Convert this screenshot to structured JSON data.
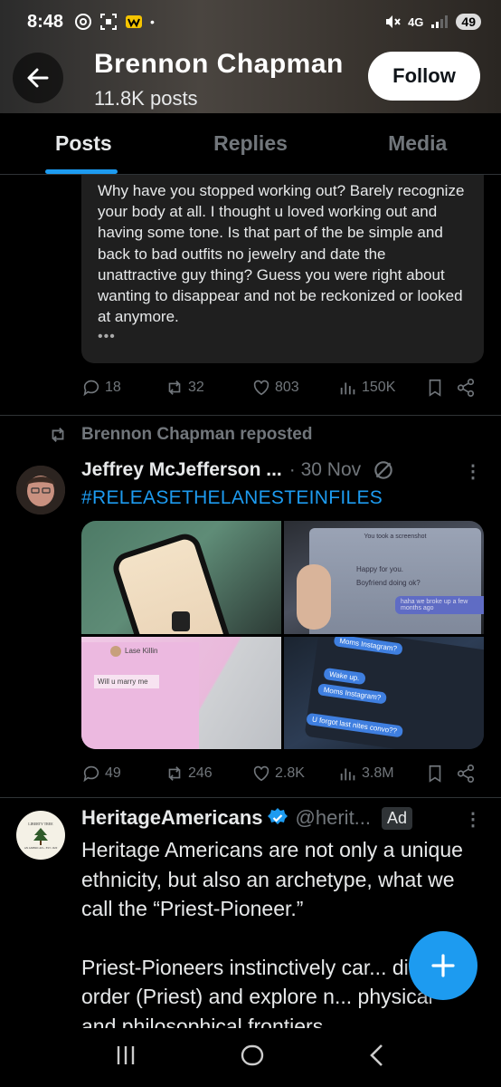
{
  "status_bar": {
    "time": "8:48",
    "network": "4G",
    "battery": "49"
  },
  "header": {
    "name": "Brennon Chapman",
    "posts_count": "11.8K posts",
    "follow_label": "Follow"
  },
  "tabs": [
    {
      "label": "Posts",
      "active": true
    },
    {
      "label": "Replies",
      "active": false
    },
    {
      "label": "Media",
      "active": false
    }
  ],
  "post1": {
    "quote_text": "Why have you stopped working out? Barely recognize your body at all. I thought u loved working out and having some tone.  Is that part of the be simple and back to bad outfits no jewelry and date the unattractive guy thing? Guess you were right about wanting to disappear and not be reckonized or looked at anymore.",
    "more": "•••",
    "replies": "18",
    "reposts": "32",
    "likes": "803",
    "views": "150K"
  },
  "post2": {
    "repost_label": "Brennon Chapman reposted",
    "author": "Jeffrey McJefferson ...",
    "date": "· 30 Nov",
    "text": "#RELEASETHELANESTEINFILES",
    "media": {
      "m2_line1": "You took a screenshot",
      "m2_line2": "Happy for you.",
      "m2_line3": "Boyfriend doing ok?",
      "m2_line4": "haha we broke up a few months ago",
      "m3_name": "Lase Killin",
      "m3_msg": "Will u marry me",
      "m4_line1": "Moms Instagram?",
      "m4_line2": "Wake up.",
      "m4_line3": "Moms Instagram?",
      "m4_line4": "U forgot last nites convo??"
    },
    "replies": "49",
    "reposts": "246",
    "likes": "2.8K",
    "views": "3.8M"
  },
  "post3": {
    "author": "HeritageAmericans",
    "handle": "@herit...",
    "ad_label": "Ad",
    "avatar_line1": "LIBERTY TREE",
    "avatar_line2": "AN AMERICAN... EST. 1620",
    "text_p1": "Heritage Americans are not only a unique ethnicity, but also an archetype, what we call the “Priest-Pioneer.”",
    "text_p2": "Priest-Pioneers instinctively car... divine order (Priest) and explore n... physical and philosophical frontiers"
  },
  "colors": {
    "accent": "#1d9bf0",
    "background": "#000000",
    "muted": "#71767b"
  },
  "icons": [
    "back-arrow-icon",
    "reply-icon",
    "repost-icon",
    "like-icon",
    "views-icon",
    "bookmark-icon",
    "share-icon",
    "muted-icon",
    "more-icon",
    "verified-icon",
    "plus-icon"
  ]
}
